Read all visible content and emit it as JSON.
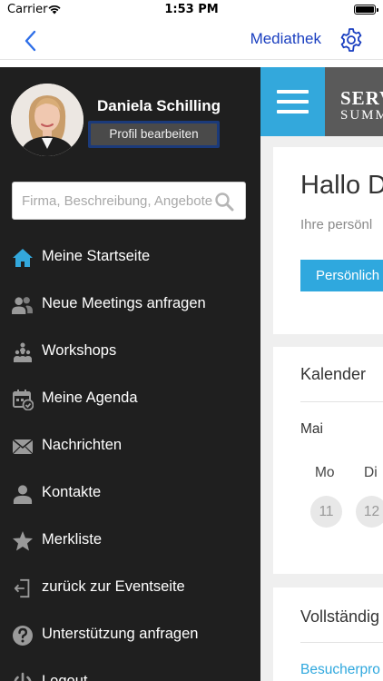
{
  "status_bar": {
    "carrier": "Carrier",
    "time": "1:53 PM"
  },
  "nav": {
    "title": "Mediathek",
    "back_icon": "chevron-left-icon",
    "settings_icon": "gear-icon",
    "accent_color": "#1a3fc0"
  },
  "sidebar": {
    "profile_name": "Daniela Schilling",
    "profile_edit_label": "Profil bearbeiten",
    "search_placeholder": "Firma, Beschreibung, Angebote",
    "items": [
      {
        "label": "Meine Startseite",
        "icon": "home-icon",
        "active": true
      },
      {
        "label": "Neue Meetings anfragen",
        "icon": "people-icon"
      },
      {
        "label": "Workshops",
        "icon": "workshop-icon"
      },
      {
        "label": "Meine Agenda",
        "icon": "calendar-icon"
      },
      {
        "label": "Nachrichten",
        "icon": "envelope-icon"
      },
      {
        "label": "Kontakte",
        "icon": "person-icon"
      },
      {
        "label": "Merkliste",
        "icon": "star-icon"
      },
      {
        "label": "zurück zur Eventseite",
        "icon": "exit-icon"
      },
      {
        "label": "Unterstützung anfragen",
        "icon": "help-icon"
      },
      {
        "label": "Logout",
        "icon": "power-icon"
      }
    ],
    "background": "#1f1f1f",
    "active_icon_color": "#33a8dc"
  },
  "content": {
    "brand_line1": "SERV",
    "brand_line2": "SUMM",
    "greeting": "Hallo D",
    "greeting_sub": "Ihre persönl",
    "profile_button": "Persönlich",
    "calendar_title": "Kalender",
    "calendar_month": "Mai",
    "weekdays": [
      "Mo",
      "Di"
    ],
    "dates": [
      "11",
      "12"
    ],
    "completion_title": "Vollständig",
    "completion_link": "Besucherpro",
    "accent_color": "#2fa8de"
  }
}
